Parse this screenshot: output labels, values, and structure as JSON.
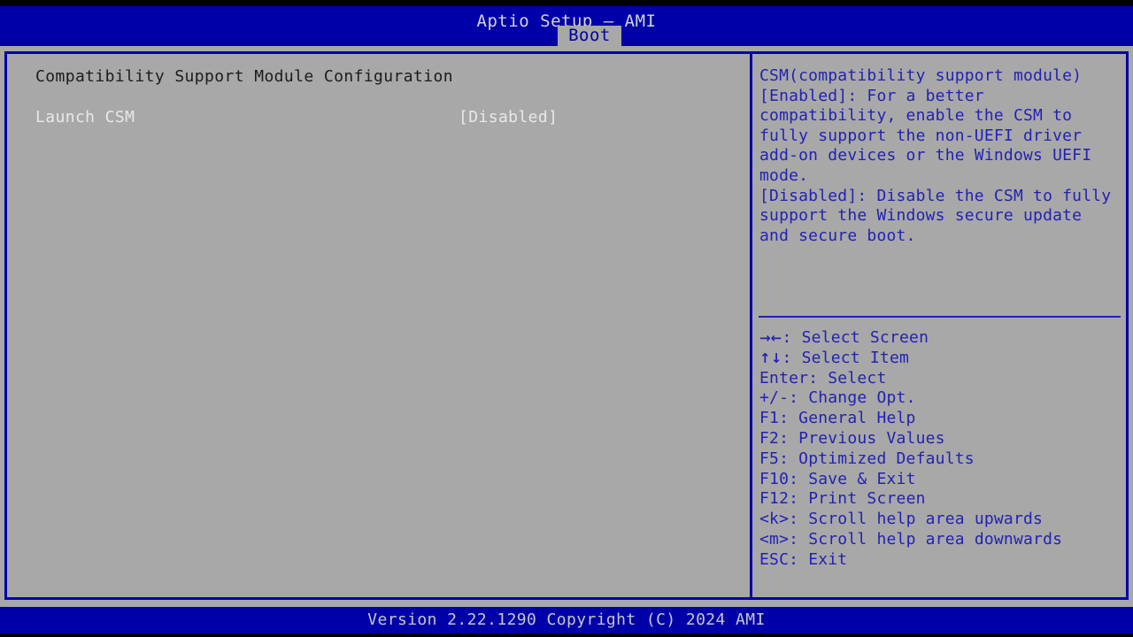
{
  "app": {
    "title": "Aptio Setup – AMI",
    "active_tab": "Boot",
    "colors": {
      "header_blue": "#0000a8",
      "panel_gray": "#a8a8a8",
      "help_blue": "#2222b4",
      "value_white": "#e8e8e8",
      "title_dark": "#1c1c1c"
    }
  },
  "main": {
    "section_title": "Compatibility Support Module Configuration",
    "settings": [
      {
        "label": "Launch CSM",
        "value": "[Disabled]"
      }
    ]
  },
  "help": {
    "body": "CSM(compatibility support module)\n[Enabled]: For a better compatibility, enable the CSM to fully support the non-UEFI driver add-on devices or the Windows UEFI mode.\n[Disabled]: Disable the CSM to fully support the Windows secure update and secure boot.",
    "keys": [
      {
        "glyph": "→←",
        "key": "",
        "text": ": Select Screen"
      },
      {
        "glyph": "↑↓",
        "key": "",
        "text": ": Select Item"
      },
      {
        "glyph": "",
        "key": "Enter",
        "text": ": Select"
      },
      {
        "glyph": "",
        "key": "+/-",
        "text": ": Change Opt."
      },
      {
        "glyph": "",
        "key": "F1",
        "text": ": General Help"
      },
      {
        "glyph": "",
        "key": "F2",
        "text": ": Previous Values"
      },
      {
        "glyph": "",
        "key": "F5",
        "text": ": Optimized Defaults"
      },
      {
        "glyph": "",
        "key": "F10",
        "text": ": Save & Exit"
      },
      {
        "glyph": "",
        "key": "F12",
        "text": ": Print Screen"
      },
      {
        "glyph": "",
        "key": "<k>",
        "text": ": Scroll help area upwards"
      },
      {
        "glyph": "",
        "key": "<m>",
        "text": ": Scroll help area downwards"
      },
      {
        "glyph": "",
        "key": "ESC",
        "text": ": Exit"
      }
    ]
  },
  "footer": {
    "version_text": "Version 2.22.1290 Copyright (C) 2024 AMI"
  }
}
